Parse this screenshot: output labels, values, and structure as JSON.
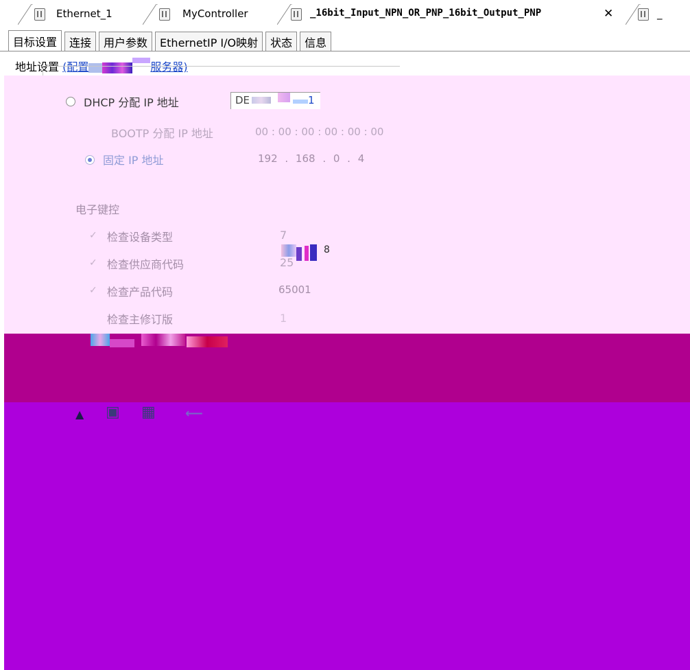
{
  "tabs": [
    {
      "label": "Ethernet_1"
    },
    {
      "label": "MyController"
    },
    {
      "label": "_16bit_Input_NPN_OR_PNP_16bit_Output_PNP"
    },
    {
      "label": "_"
    }
  ],
  "close_symbol": "✕",
  "subtabs": [
    {
      "label": "目标设置"
    },
    {
      "label": "连接"
    },
    {
      "label": "用户参数"
    },
    {
      "label": "EthernetIP I/O映射"
    },
    {
      "label": "状态"
    },
    {
      "label": "信息"
    }
  ],
  "address_settings": {
    "title": "地址设置",
    "link_prefix": "(配置",
    "link_suffix": "服务器)",
    "dhcp_label": "DHCP 分配 IP 地址",
    "dhcp_value_prefix": "DE",
    "dhcp_value_suffix": "1",
    "bootp_label": "BOOTP 分配 IP 地址",
    "bootp_value": "00 : 00 : 00 : 00 : 00 : 00",
    "fixed_label": "固定 IP 地址",
    "fixed_value": "192 . 168 . 0 . 4"
  },
  "electronic_keying": {
    "title": "电子键控",
    "rows": [
      {
        "label": "检查设备类型",
        "value": "7",
        "checked": true
      },
      {
        "label": "检查供应商代码",
        "value": "25",
        "checked": true
      },
      {
        "label": "检查产品代码",
        "value": "65001",
        "checked": true
      },
      {
        "label": "检查主修订版",
        "value": "1",
        "checked": false
      }
    ],
    "extra_glyph": "8"
  },
  "colors": {
    "link": "#1a47c8",
    "panel_light": "#ffe4ff",
    "panel_dark": "#b0008e",
    "panel_violet": "#ad00dc"
  }
}
